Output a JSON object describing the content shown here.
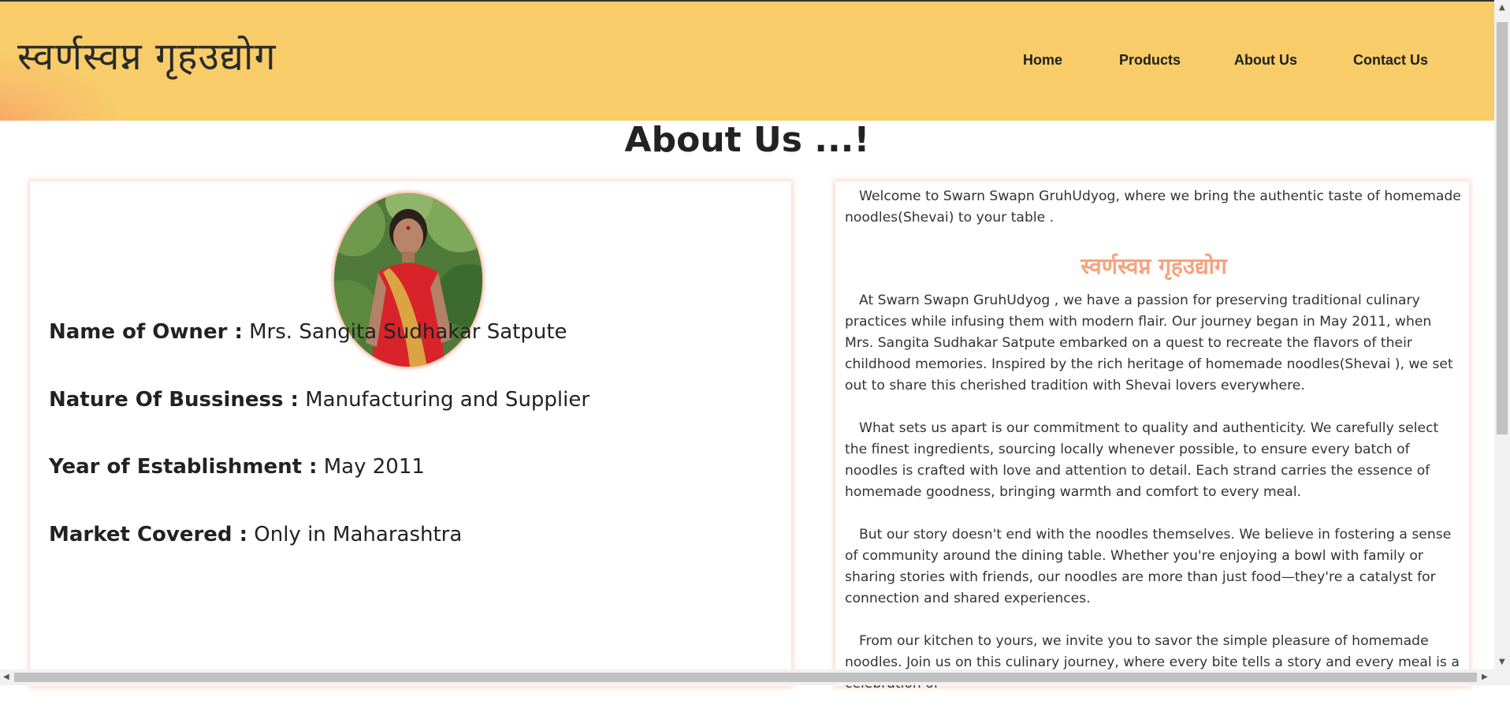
{
  "header": {
    "brand": "स्वर्णस्वप्न  गृहउद्योग",
    "nav": [
      {
        "label": "Home"
      },
      {
        "label": "Products"
      },
      {
        "label": "About Us"
      },
      {
        "label": "Contact Us"
      }
    ]
  },
  "page": {
    "title": "About Us ...!"
  },
  "owner_card": {
    "photo_alt": "Owner photo",
    "rows": [
      {
        "label": "Name of Owner :",
        "value": "Mrs. Sangita Sudhakar Satpute"
      },
      {
        "label": "Nature Of Bussiness :",
        "value": "Manufacturing and Supplier"
      },
      {
        "label": "Year of Establishment :",
        "value": "May 2011"
      },
      {
        "label": "Market Covered :",
        "value": "Only in Maharashtra"
      }
    ]
  },
  "about": {
    "intro": "Welcome to Swarn Swapn GruhUdyog, where we bring the authentic taste of homemade noodles(Shevai) to your table .",
    "brand_heading": "स्वर्णस्वप्न गृहउद्योग",
    "paragraphs": [
      "At Swarn Swapn GruhUdyog , we have a passion for preserving traditional culinary practices while infusing them with modern flair. Our journey began in May 2011, when Mrs. Sangita Sudhakar Satpute embarked on a quest to recreate the flavors of their childhood memories. Inspired by the rich heritage of homemade noodles(Shevai ), we set out to share this cherished tradition with Shevai lovers everywhere.",
      "What sets us apart is our commitment to quality and authenticity. We carefully select the finest ingredients, sourcing locally whenever possible, to ensure every batch of noodles is crafted with love and attention to detail. Each strand carries the essence of homemade goodness, bringing warmth and comfort to every meal.",
      "But our story doesn't end with the noodles themselves. We believe in fostering a sense of community around the dining table. Whether you're enjoying a bowl with family or sharing stories with friends, our noodles are more than just food—they're a catalyst for connection and shared experiences.",
      "From our kitchen to yours, we invite you to savor the simple pleasure of homemade noodles. Join us on this culinary journey, where every bite tells a story and every meal is a celebration of"
    ]
  },
  "colors": {
    "header_bg": "#f8cd69",
    "accent": "#f7a27a"
  }
}
